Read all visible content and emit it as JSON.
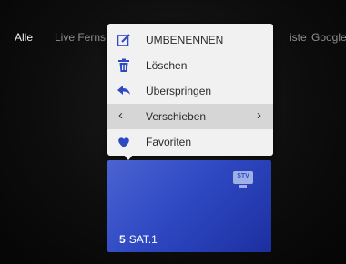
{
  "tabs": [
    {
      "label": "Alle",
      "active": true
    },
    {
      "label": "Live Ferns",
      "active": false
    },
    {
      "label": "iste",
      "active": false
    },
    {
      "label": "Google",
      "active": false
    }
  ],
  "context_menu": {
    "items": [
      {
        "label": "UMBENENNEN",
        "icon": "edit-icon"
      },
      {
        "label": "Löschen",
        "icon": "trash-icon"
      },
      {
        "label": "Überspringen",
        "icon": "skip-back-arrow-icon"
      },
      {
        "label": "Verschieben",
        "icon": "move-arrows-icon",
        "selected": true
      },
      {
        "label": "Favoriten",
        "icon": "heart-icon"
      }
    ]
  },
  "channel_card": {
    "number": "5",
    "name": "SAT.1",
    "logo_text": "STV",
    "accent_color": "#3550c8"
  }
}
